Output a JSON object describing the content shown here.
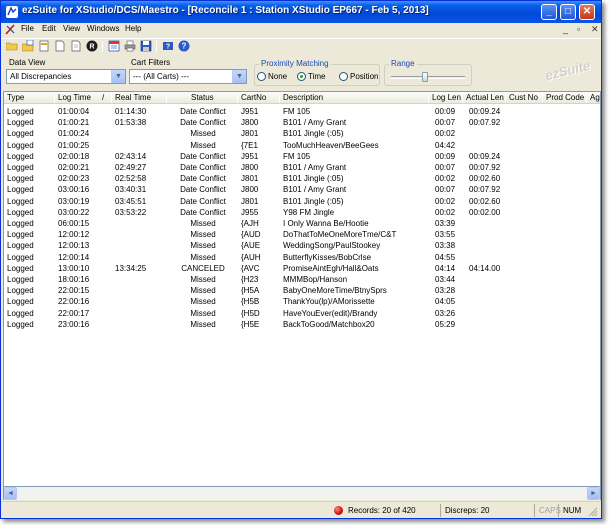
{
  "window": {
    "title": "ezSuite for XStudio/DCS/Maestro - [Reconcile 1 :  Station XStudio EP667 - Feb 5, 2013]"
  },
  "menu": {
    "items": [
      "File",
      "Edit",
      "View",
      "Windows",
      "Help"
    ]
  },
  "titlebar_buttons": {
    "minimize": "_",
    "maximize": "□",
    "close": "✕"
  },
  "mdi_controls": {
    "minimize": "_",
    "restore": "▫",
    "close": "✕"
  },
  "toolbar": {
    "tools": [
      "open-folder-icon",
      "open-file-icon",
      "document-icon",
      "new-document-icon",
      "page-icon",
      "reconcile-icon",
      "report-icon",
      "print-icon",
      "save-icon",
      "help-book-icon",
      "help-icon"
    ]
  },
  "filters": {
    "data_view_label": "Data View",
    "data_view_value": "All Discrepancies",
    "cart_filters_label": "Cart Filters",
    "cart_filters_value": "--- (All Carts) ---",
    "proximity_label": "Proximity Matching",
    "proximity_options": [
      "None",
      "Time",
      "Position"
    ],
    "proximity_selected": "Time",
    "range_label": "Range",
    "range_level": 0.45,
    "logo_text": "ezSuite"
  },
  "grid": {
    "columns": [
      "Type",
      "Log Time",
      "/",
      "Real Time",
      "Status",
      "CartNo",
      "Description",
      "Log Len",
      "Actual Len",
      "Cust No",
      "Prod Code",
      "Age"
    ],
    "rows": [
      [
        "Logged",
        "01:00:04",
        "01:14:30",
        "Date Conflict",
        "J951",
        "FM 105",
        "00:09",
        "00:09.24"
      ],
      [
        "Logged",
        "01:00:21",
        "01:53:38",
        "Date Conflict",
        "J800",
        "B101 / Amy Grant",
        "00:07",
        "00:07.92"
      ],
      [
        "Logged",
        "01:00:24",
        "",
        "Missed",
        "J801",
        "B101 Jingle (:05)",
        "00:02",
        ""
      ],
      [
        "Logged",
        "01:00:25",
        "",
        "Missed",
        "{7E1",
        "TooMuchHeaven/BeeGees",
        "04:42",
        ""
      ],
      [
        "Logged",
        "02:00:18",
        "02:43:14",
        "Date Conflict",
        "J951",
        "FM 105",
        "00:09",
        "00:09.24"
      ],
      [
        "Logged",
        "02:00:21",
        "02:49:27",
        "Date Conflict",
        "J800",
        "B101 / Amy Grant",
        "00:07",
        "00:07.92"
      ],
      [
        "Logged",
        "02:00:23",
        "02:52:58",
        "Date Conflict",
        "J801",
        "B101 Jingle (:05)",
        "00:02",
        "00:02.60"
      ],
      [
        "Logged",
        "03:00:16",
        "03:40:31",
        "Date Conflict",
        "J800",
        "B101 / Amy Grant",
        "00:07",
        "00:07.92"
      ],
      [
        "Logged",
        "03:00:19",
        "03:45:51",
        "Date Conflict",
        "J801",
        "B101 Jingle (:05)",
        "00:02",
        "00:02.60"
      ],
      [
        "Logged",
        "03:00:22",
        "03:53:22",
        "Date Conflict",
        "J955",
        "Y98 FM Jingle",
        "00:02",
        "00:02.00"
      ],
      [
        "Logged",
        "06:00:15",
        "",
        "Missed",
        "{AJH",
        "I Only Wanna Be/Hootie",
        "03:39",
        ""
      ],
      [
        "Logged",
        "12:00:12",
        "",
        "Missed",
        "{AUD",
        "DoThatToMeOneMoreTme/C&T",
        "03:55",
        ""
      ],
      [
        "Logged",
        "12:00:13",
        "",
        "Missed",
        "{AUE",
        "WeddingSong/PaulStookey",
        "03:38",
        ""
      ],
      [
        "Logged",
        "12:00:14",
        "",
        "Missed",
        "{AUH",
        "ButterflyKisses/BobCrlse",
        "04:55",
        ""
      ],
      [
        "Logged",
        "13:00:10",
        "13:34:25",
        "CANCELED",
        "{AVC",
        "PromiseAintEgh/Hall&Oats",
        "04:14",
        "04:14.00"
      ],
      [
        "Logged",
        "18:00:16",
        "",
        "Missed",
        "{H23",
        "MMMBop/Hanson",
        "03:44",
        ""
      ],
      [
        "Logged",
        "22:00:15",
        "",
        "Missed",
        "{H5A",
        "BabyOneMoreTime/BtnySprs",
        "03:28",
        ""
      ],
      [
        "Logged",
        "22:00:16",
        "",
        "Missed",
        "{H5B",
        "ThankYou(lp)/AMorissette",
        "04:05",
        ""
      ],
      [
        "Logged",
        "22:00:17",
        "",
        "Missed",
        "{H5D",
        "HaveYouEver(edit)/Brandy",
        "03:26",
        ""
      ],
      [
        "Logged",
        "23:00:16",
        "",
        "Missed",
        "{H5E",
        "BackToGood/Matchbox20",
        "05:29",
        ""
      ]
    ]
  },
  "scrollbar": {
    "left_arrow": "◄",
    "right_arrow": "►"
  },
  "status": {
    "records": "Records: 20 of 420",
    "discreps": "Discreps: 20",
    "caps": "CAPS",
    "num": "NUM"
  }
}
